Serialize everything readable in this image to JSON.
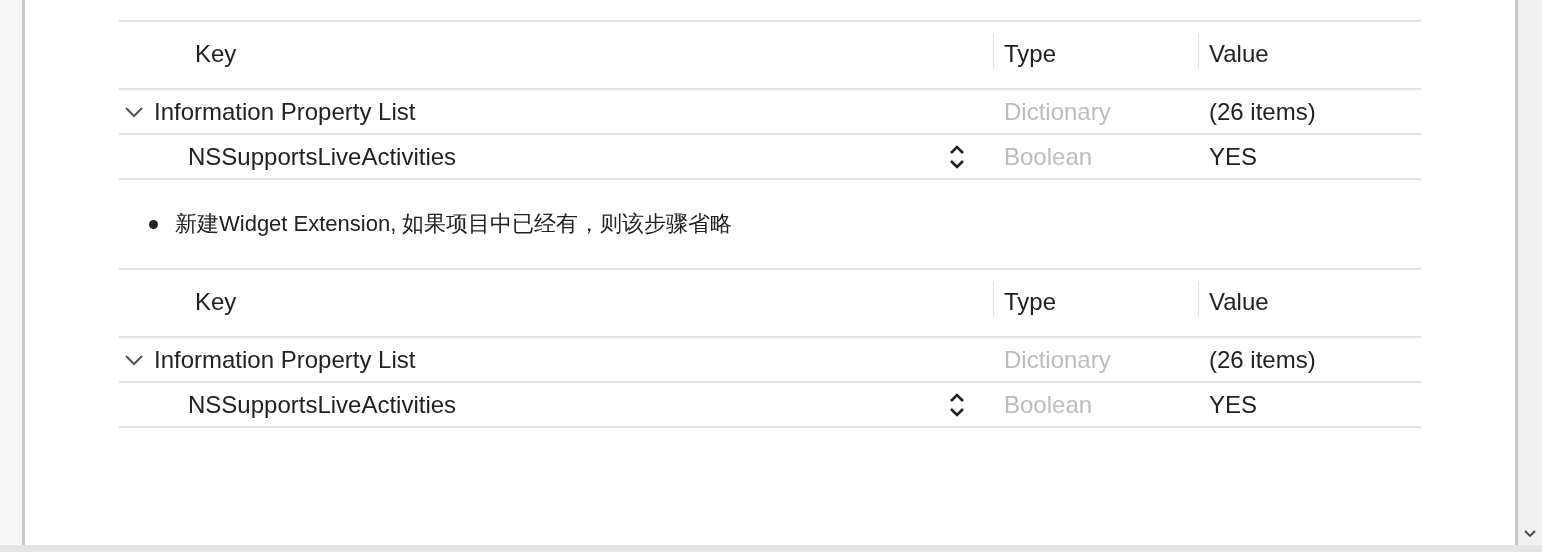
{
  "blocks": [
    {
      "kind": "table",
      "columns": [
        "Key",
        "Type",
        "Value"
      ],
      "rows": [
        {
          "key": "Information Property List",
          "type": "Dictionary",
          "value": "(26 items)",
          "expanded": true,
          "children": [
            {
              "key": "NSSupportsLiveActivities",
              "type": "Boolean",
              "value": "YES"
            }
          ]
        }
      ]
    },
    {
      "kind": "bullet",
      "text": "新建Widget Extension, 如果项目中已经有，则该步骤省略"
    },
    {
      "kind": "table",
      "columns": [
        "Key",
        "Type",
        "Value"
      ],
      "rows": [
        {
          "key": "Information Property List",
          "type": "Dictionary",
          "value": "(26 items)",
          "expanded": true,
          "children": [
            {
              "key": "NSSupportsLiveActivities",
              "type": "Boolean",
              "value": "YES"
            }
          ]
        }
      ]
    }
  ]
}
